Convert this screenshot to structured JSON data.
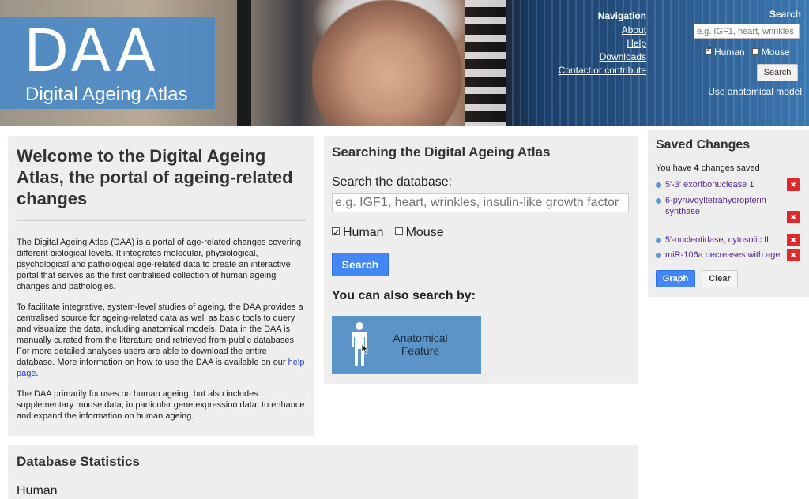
{
  "header": {
    "logo": {
      "mark": "DAA",
      "subtitle": "Digital Ageing Atlas"
    },
    "navigation": {
      "title": "Navigation",
      "links": [
        "About",
        "Help",
        "Downloads",
        "Contact or contribute"
      ]
    },
    "search": {
      "title": "Search",
      "placeholder": "e.g. IGF1, heart, wrinkles",
      "value": "",
      "human_label": "Human",
      "human_checked": true,
      "mouse_label": "Mouse",
      "mouse_checked": false,
      "button_label": "Search",
      "anatomical_link": "Use anatomical model"
    }
  },
  "welcome": {
    "title": "Welcome to the Digital Ageing Atlas, the portal of ageing-related changes",
    "p1": "The Digital Ageing Atlas (DAA) is a portal of age-related changes covering different biological levels. It integrates molecular, physiological, psychological and pathological age-related data to create an interactive portal that serves as the first centralised collection of human ageing changes and pathologies.",
    "p2_text": "To facilitate integrative, system-level studies of ageing, the DAA provides a centralised source for ageing-related data as well as basic tools to query and visualize the data, including anatomical models. Data in the DAA is manually curated from the literature and retrieved from public databases. For more detailed analyses users are able to download the entire database. More information on how to use the DAA is available on our",
    "p2_link": "help page",
    "p2_end": ".",
    "p3": "The DAA primarily focuses on human ageing, but also includes supplementary mouse data, in particular gene expression data, to enhance and expand the information on human ageing."
  },
  "search_panel": {
    "title": "Searching the Digital Ageing Atlas",
    "label": "Search the database:",
    "placeholder": "e.g. IGF1, heart, wrinkles, insulin-like growth factor",
    "value": "",
    "human_label": "Human",
    "human_checked": true,
    "mouse_label": "Mouse",
    "mouse_checked": false,
    "button_label": "Search",
    "also_label": "You can also search by:",
    "tile_line1": "Anatomical",
    "tile_line2": "Feature",
    "tile_icon": "human-figure-icon"
  },
  "saved": {
    "title": "Saved Changes",
    "count_prefix": "You have",
    "count": "4",
    "count_suffix": "changes saved",
    "items": [
      {
        "label": "5'-3' exoribonuclease 1"
      },
      {
        "label": "6-pyruvoyltetrahydropterin synthase"
      },
      {
        "label": "5'-nucleotidase, cytosolic II"
      },
      {
        "label": "miR-106a decreases with age"
      }
    ],
    "delete_icon": "x-icon",
    "graph_label": "Graph",
    "clear_label": "Clear"
  },
  "stats": {
    "title": "Database Statistics",
    "subtitle": "Human"
  },
  "colors": {
    "header_blue": "#3c77b0",
    "logo_blue": "#488ac8",
    "primary_button": "#4287f5",
    "panel_bg": "#eeeeee",
    "delete_red": "#e02a2a",
    "saved_link": "#5a2a86"
  }
}
